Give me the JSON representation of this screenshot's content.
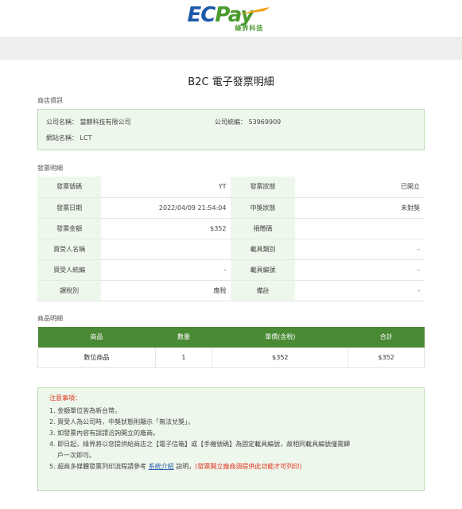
{
  "header": {
    "logo_ec": "EC",
    "logo_pay": "Pay",
    "logo_sub": "綠界科技"
  },
  "title": "B2C 電子發票明細",
  "shop": {
    "section_label": "商店資訊",
    "company_name": "公司名稱：   當麒科技有限公司",
    "company_taxid": "公司統編：   53969909",
    "site_name": "網站名稱：   LCT"
  },
  "invoice": {
    "section_label": "發票明細",
    "rows": [
      {
        "l1": "發票號碼",
        "v1": "YT",
        "l2": "發票狀態",
        "v2": "已開立"
      },
      {
        "l1": "發票日期",
        "v1": "2022/04/09 21:54:04",
        "l2": "中獎狀態",
        "v2": "未對獎"
      },
      {
        "l1": "發票金額",
        "v1": "$352",
        "l2": "捐贈碼",
        "v2": ""
      },
      {
        "l1": "買受人名稱",
        "v1": "",
        "l2": "載具類別",
        "v2": "-"
      },
      {
        "l1": "買受人統編",
        "v1": "-",
        "l2": "載具編號",
        "v2": "-"
      },
      {
        "l1": "課稅別",
        "v1": "應稅",
        "l2": "備註",
        "v2": "-"
      }
    ]
  },
  "products": {
    "section_label": "商品明細",
    "headers": [
      "商品",
      "數量",
      "單價(含稅)",
      "合計"
    ],
    "rows": [
      [
        "數位商品",
        "1",
        "$352",
        "$352"
      ]
    ]
  },
  "notes": {
    "title": "注意事項：",
    "items": [
      "1. 金額單位皆為新台幣。",
      "2. 買受人為公司時，中獎狀態則顯示「無法兌獎」。",
      "3. 如發票內容有誤請洽詢開立的廠商。",
      "4. 即日起，綠界將以您提供給商店之【電子信箱】或【手機號碼】為固定載具編號，故相同載具編號僅需歸",
      "戶一次即可。"
    ],
    "item5_prefix": "5. 超商多媒體發票列印流程請參考 ",
    "item5_link": "系統介紹",
    "item5_mid": " 說明，",
    "item5_red": "(發票開立廠商須提供此功能才可列印)"
  },
  "colors": {
    "brand_blue": "#1d5aa8",
    "brand_green": "#4a9a2e",
    "table_header_green": "#4b8a35",
    "panel_green": "#eef7ec",
    "alert_red": "#e0301e"
  }
}
